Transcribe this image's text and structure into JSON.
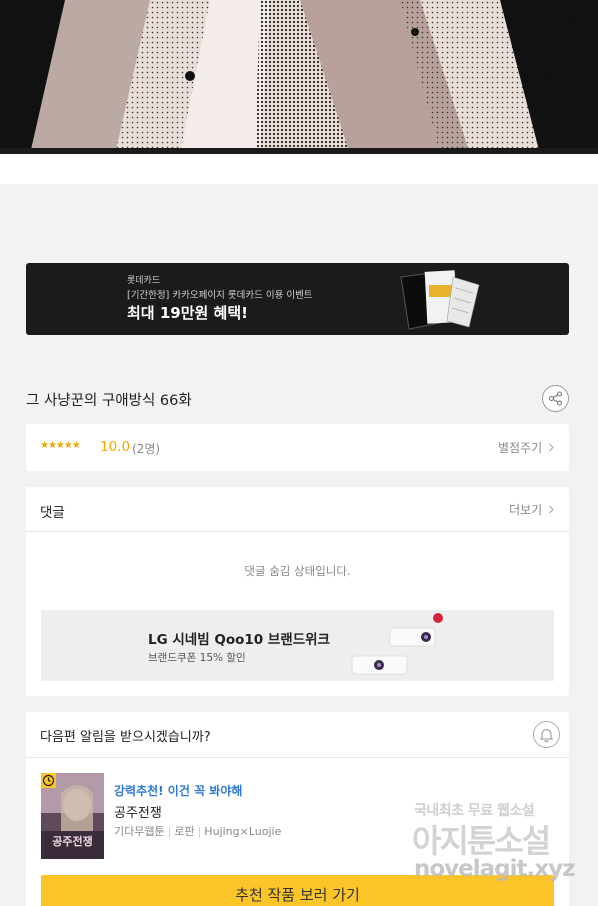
{
  "banner": {
    "brand": "롯데카드",
    "line1": "[기간한정] 카카오페이지 롯데카드 이용 이벤트",
    "headline": "최대 19만원 혜택!"
  },
  "episode": {
    "title": "그 사냥꾼의 구애방식 66화"
  },
  "rating": {
    "stars": "★★★★★",
    "score": "10.0",
    "count": "(2명)",
    "rate_label": "별점주기"
  },
  "comments": {
    "title": "댓글",
    "more_label": "더보기",
    "hidden_message": "댓글 숨김 상태입니다.",
    "ad": {
      "title": "LG 시네빔 Qoo10 브랜드위크",
      "subtitle": "브랜드쿠폰 15% 할인"
    }
  },
  "next": {
    "question": "다음편 알림을 받으시겠습니까?",
    "recommend_label": "강력추천! 이건 꼭 봐야해",
    "work_title": "공주전쟁",
    "meta": [
      "기다무웹툰",
      "로판",
      "Hujing×Luojie"
    ],
    "cover_title": "공주전쟁",
    "cta_label": "추천 작품 보러 가기"
  },
  "watermark": {
    "line1": "국내최초 무료 웹소설",
    "line2": "아지툰소설",
    "line3": "novelagit.xyz"
  },
  "icons": {
    "share": "share-icon",
    "bell": "bell-icon",
    "clock": "clock-icon",
    "chevron": "chevron-right-icon"
  },
  "colors": {
    "accent_yellow": "#fbc52a",
    "star": "#f0a700",
    "link_blue": "#2f78d6"
  }
}
